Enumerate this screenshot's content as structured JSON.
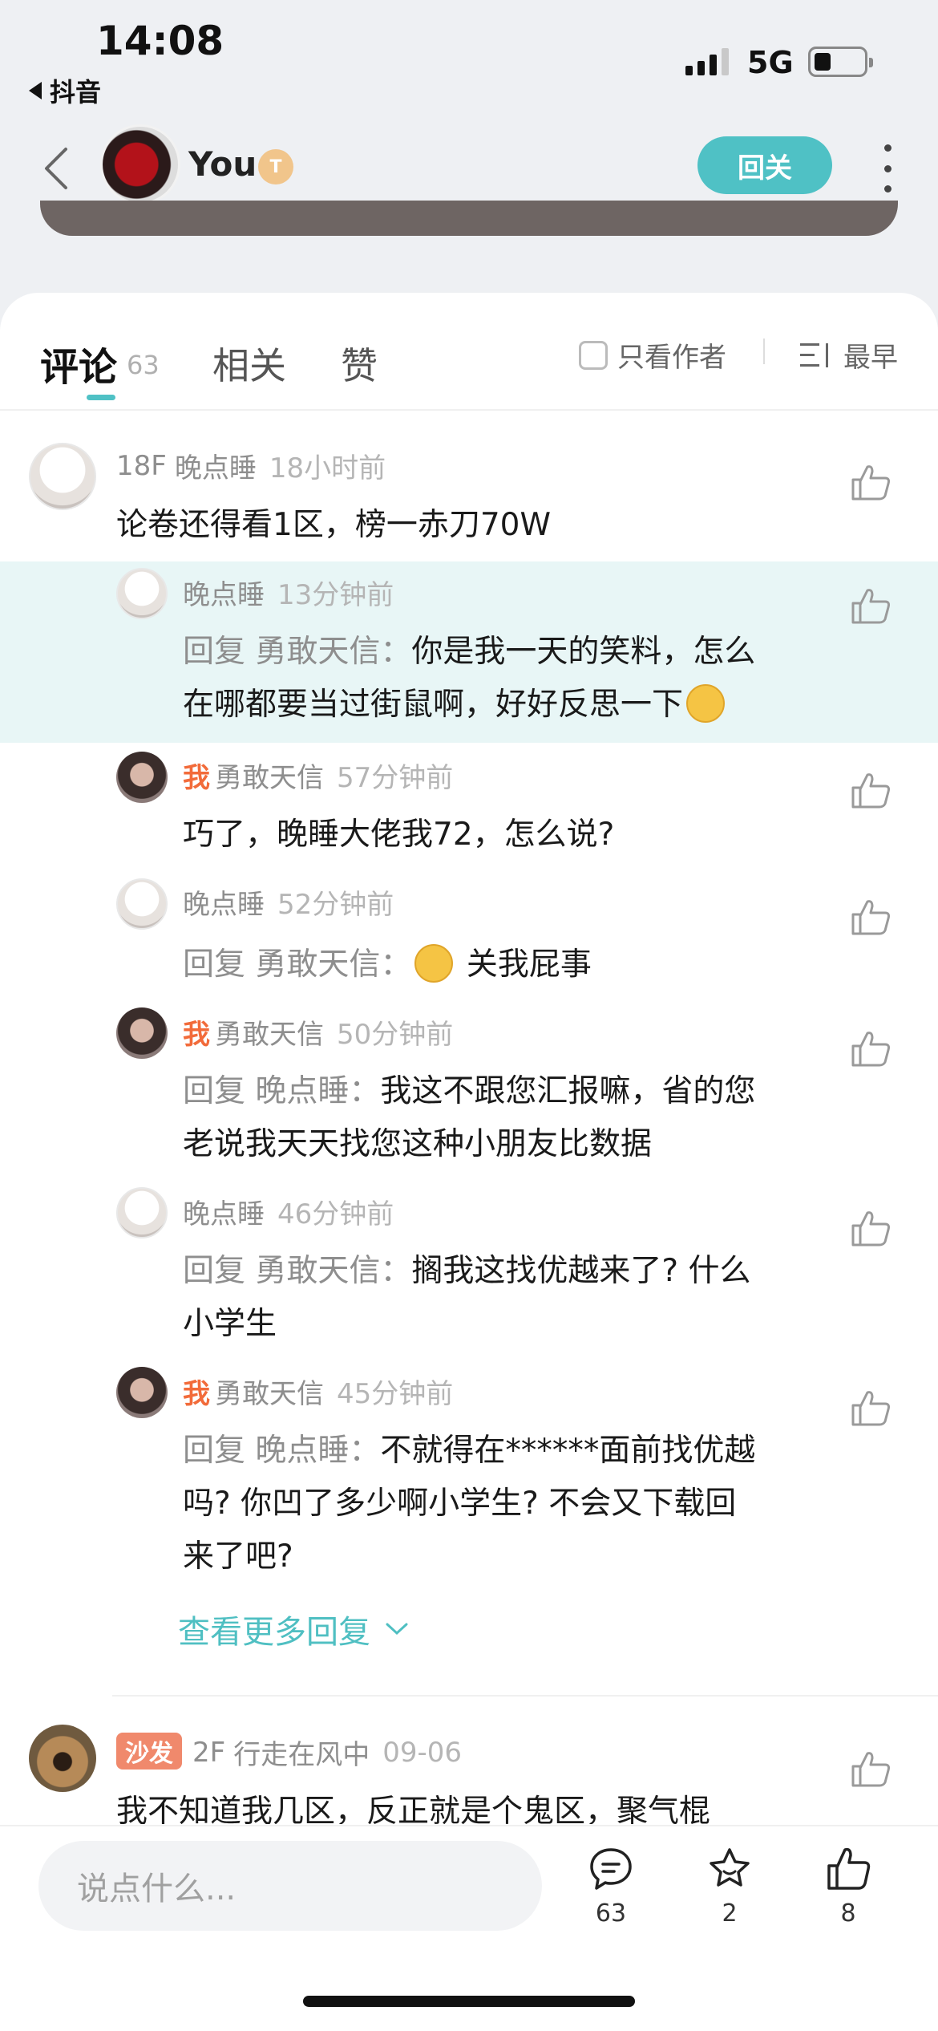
{
  "status_bar": {
    "time": "14:08",
    "back_app": "抖音",
    "network": "5G"
  },
  "header": {
    "author_name": "You",
    "badge": "T",
    "follow_label": "回关"
  },
  "tabs": {
    "comments_label": "评论",
    "comments_count": "63",
    "related_label": "相关",
    "likes_label": "赞",
    "author_only_label": "只看作者",
    "sort_label": "最早"
  },
  "comments": [
    {
      "floor": "18F",
      "author": "晚点睡",
      "time": "18小时前",
      "text": "论卷还得看1区，榜一赤刀70W",
      "replies": [
        {
          "is_me": false,
          "author": "晚点睡",
          "time": "13分钟前",
          "reply_prefix": "回复 勇敢天信：",
          "lines": [
            "你是我一天的笑料，怎么",
            "在哪都要当过街鼠啊，好好反思一下"
          ]
        },
        {
          "is_me": true,
          "me_tag": "我",
          "author": "勇敢天信",
          "time": "57分钟前",
          "reply_prefix": "",
          "lines": [
            "巧了，晚睡大佬我72，怎么说?"
          ]
        },
        {
          "is_me": false,
          "author": "晚点睡",
          "time": "52分钟前",
          "reply_prefix": "回复 勇敢天信：",
          "lines": [
            "关我屁事"
          ]
        },
        {
          "is_me": true,
          "me_tag": "我",
          "author": "勇敢天信",
          "time": "50分钟前",
          "reply_prefix": "回复 晚点睡：",
          "lines": [
            "我这不跟您汇报嘛，省的您",
            "老说我天天找您这种小朋友比数据"
          ]
        },
        {
          "is_me": false,
          "author": "晚点睡",
          "time": "46分钟前",
          "reply_prefix": "回复 勇敢天信：",
          "lines": [
            "搁我这找优越来了? 什么",
            "小学生"
          ]
        },
        {
          "is_me": true,
          "me_tag": "我",
          "author": "勇敢天信",
          "time": "45分钟前",
          "reply_prefix": "回复 晚点睡：",
          "lines": [
            "不就得在******面前找优越",
            "吗? 你凹了多少啊小学生? 不会又下载回",
            "来了吧?"
          ]
        }
      ],
      "view_more": "查看更多回复"
    },
    {
      "badge": "沙发",
      "floor": "2F",
      "author": "行走在风中",
      "time": "09-06",
      "text": "我不知道我几区，反正就是个鬼区，聚气棍"
    }
  ],
  "bottom_bar": {
    "input_placeholder": "说点什么...",
    "comments_count": "63",
    "favorites_count": "2",
    "likes_count": "8"
  }
}
